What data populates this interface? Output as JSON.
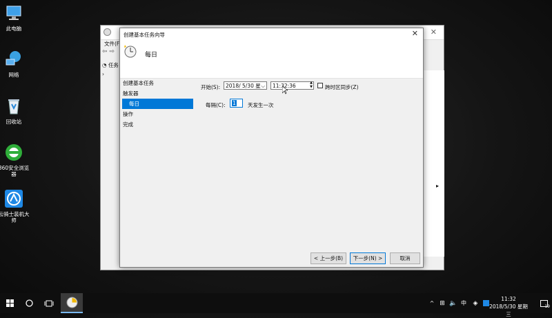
{
  "desktop": {
    "icons": [
      {
        "label": "此电脑"
      },
      {
        "label": "网络"
      },
      {
        "label": "回收站"
      },
      {
        "label": "360安全浏览器"
      },
      {
        "label": "云骑士装机大师"
      }
    ]
  },
  "bg_window": {
    "menu_label": "文件(F)",
    "tree_label": "任务"
  },
  "dialog": {
    "title": "创建基本任务向导",
    "header_title": "每日",
    "nav": [
      {
        "label": "创建基本任务"
      },
      {
        "label": "触发器"
      },
      {
        "label": "每日"
      },
      {
        "label": "操作"
      },
      {
        "label": "完成"
      }
    ],
    "start_label": "开始(S):",
    "date_value": "2018/ 5/30 星",
    "time_value": "11:32:36",
    "sync_label": "跨时区同步(Z)",
    "recur_label": "每隔(C):",
    "recur_value": "1",
    "recur_suffix": "天发生一次",
    "back_label": "< 上一步(B)",
    "next_label": "下一步(N) >",
    "cancel_label": "取消"
  },
  "taskbar": {
    "time": "11:32",
    "date": "2018/5/30 星期三",
    "ime": "中",
    "notif_count": "19"
  }
}
